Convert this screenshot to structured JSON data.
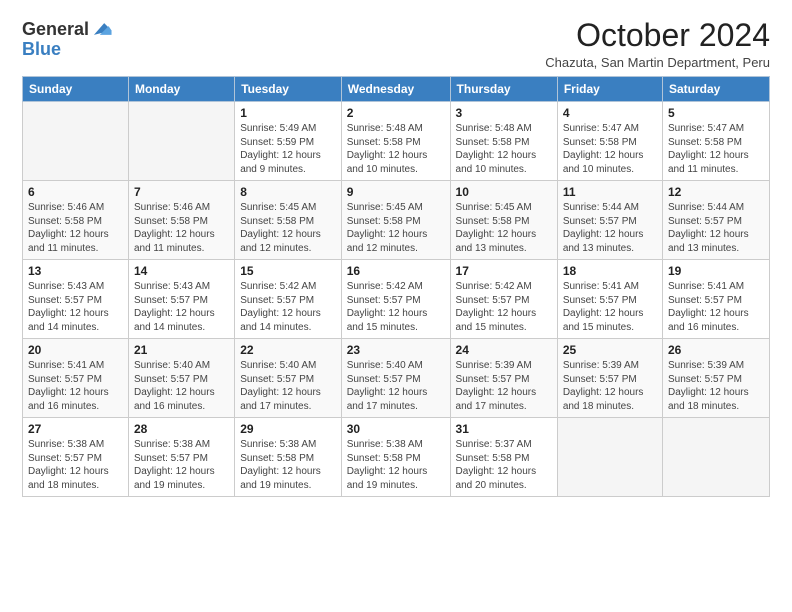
{
  "header": {
    "logo_general": "General",
    "logo_blue": "Blue",
    "month_title": "October 2024",
    "subtitle": "Chazuta, San Martin Department, Peru"
  },
  "days_of_week": [
    "Sunday",
    "Monday",
    "Tuesday",
    "Wednesday",
    "Thursday",
    "Friday",
    "Saturday"
  ],
  "weeks": [
    [
      {
        "day": "",
        "empty": true
      },
      {
        "day": "",
        "empty": true
      },
      {
        "day": "1",
        "sunrise": "Sunrise: 5:49 AM",
        "sunset": "Sunset: 5:59 PM",
        "daylight": "Daylight: 12 hours and 9 minutes."
      },
      {
        "day": "2",
        "sunrise": "Sunrise: 5:48 AM",
        "sunset": "Sunset: 5:58 PM",
        "daylight": "Daylight: 12 hours and 10 minutes."
      },
      {
        "day": "3",
        "sunrise": "Sunrise: 5:48 AM",
        "sunset": "Sunset: 5:58 PM",
        "daylight": "Daylight: 12 hours and 10 minutes."
      },
      {
        "day": "4",
        "sunrise": "Sunrise: 5:47 AM",
        "sunset": "Sunset: 5:58 PM",
        "daylight": "Daylight: 12 hours and 10 minutes."
      },
      {
        "day": "5",
        "sunrise": "Sunrise: 5:47 AM",
        "sunset": "Sunset: 5:58 PM",
        "daylight": "Daylight: 12 hours and 11 minutes."
      }
    ],
    [
      {
        "day": "6",
        "sunrise": "Sunrise: 5:46 AM",
        "sunset": "Sunset: 5:58 PM",
        "daylight": "Daylight: 12 hours and 11 minutes."
      },
      {
        "day": "7",
        "sunrise": "Sunrise: 5:46 AM",
        "sunset": "Sunset: 5:58 PM",
        "daylight": "Daylight: 12 hours and 11 minutes."
      },
      {
        "day": "8",
        "sunrise": "Sunrise: 5:45 AM",
        "sunset": "Sunset: 5:58 PM",
        "daylight": "Daylight: 12 hours and 12 minutes."
      },
      {
        "day": "9",
        "sunrise": "Sunrise: 5:45 AM",
        "sunset": "Sunset: 5:58 PM",
        "daylight": "Daylight: 12 hours and 12 minutes."
      },
      {
        "day": "10",
        "sunrise": "Sunrise: 5:45 AM",
        "sunset": "Sunset: 5:58 PM",
        "daylight": "Daylight: 12 hours and 13 minutes."
      },
      {
        "day": "11",
        "sunrise": "Sunrise: 5:44 AM",
        "sunset": "Sunset: 5:57 PM",
        "daylight": "Daylight: 12 hours and 13 minutes."
      },
      {
        "day": "12",
        "sunrise": "Sunrise: 5:44 AM",
        "sunset": "Sunset: 5:57 PM",
        "daylight": "Daylight: 12 hours and 13 minutes."
      }
    ],
    [
      {
        "day": "13",
        "sunrise": "Sunrise: 5:43 AM",
        "sunset": "Sunset: 5:57 PM",
        "daylight": "Daylight: 12 hours and 14 minutes."
      },
      {
        "day": "14",
        "sunrise": "Sunrise: 5:43 AM",
        "sunset": "Sunset: 5:57 PM",
        "daylight": "Daylight: 12 hours and 14 minutes."
      },
      {
        "day": "15",
        "sunrise": "Sunrise: 5:42 AM",
        "sunset": "Sunset: 5:57 PM",
        "daylight": "Daylight: 12 hours and 14 minutes."
      },
      {
        "day": "16",
        "sunrise": "Sunrise: 5:42 AM",
        "sunset": "Sunset: 5:57 PM",
        "daylight": "Daylight: 12 hours and 15 minutes."
      },
      {
        "day": "17",
        "sunrise": "Sunrise: 5:42 AM",
        "sunset": "Sunset: 5:57 PM",
        "daylight": "Daylight: 12 hours and 15 minutes."
      },
      {
        "day": "18",
        "sunrise": "Sunrise: 5:41 AM",
        "sunset": "Sunset: 5:57 PM",
        "daylight": "Daylight: 12 hours and 15 minutes."
      },
      {
        "day": "19",
        "sunrise": "Sunrise: 5:41 AM",
        "sunset": "Sunset: 5:57 PM",
        "daylight": "Daylight: 12 hours and 16 minutes."
      }
    ],
    [
      {
        "day": "20",
        "sunrise": "Sunrise: 5:41 AM",
        "sunset": "Sunset: 5:57 PM",
        "daylight": "Daylight: 12 hours and 16 minutes."
      },
      {
        "day": "21",
        "sunrise": "Sunrise: 5:40 AM",
        "sunset": "Sunset: 5:57 PM",
        "daylight": "Daylight: 12 hours and 16 minutes."
      },
      {
        "day": "22",
        "sunrise": "Sunrise: 5:40 AM",
        "sunset": "Sunset: 5:57 PM",
        "daylight": "Daylight: 12 hours and 17 minutes."
      },
      {
        "day": "23",
        "sunrise": "Sunrise: 5:40 AM",
        "sunset": "Sunset: 5:57 PM",
        "daylight": "Daylight: 12 hours and 17 minutes."
      },
      {
        "day": "24",
        "sunrise": "Sunrise: 5:39 AM",
        "sunset": "Sunset: 5:57 PM",
        "daylight": "Daylight: 12 hours and 17 minutes."
      },
      {
        "day": "25",
        "sunrise": "Sunrise: 5:39 AM",
        "sunset": "Sunset: 5:57 PM",
        "daylight": "Daylight: 12 hours and 18 minutes."
      },
      {
        "day": "26",
        "sunrise": "Sunrise: 5:39 AM",
        "sunset": "Sunset: 5:57 PM",
        "daylight": "Daylight: 12 hours and 18 minutes."
      }
    ],
    [
      {
        "day": "27",
        "sunrise": "Sunrise: 5:38 AM",
        "sunset": "Sunset: 5:57 PM",
        "daylight": "Daylight: 12 hours and 18 minutes."
      },
      {
        "day": "28",
        "sunrise": "Sunrise: 5:38 AM",
        "sunset": "Sunset: 5:57 PM",
        "daylight": "Daylight: 12 hours and 19 minutes."
      },
      {
        "day": "29",
        "sunrise": "Sunrise: 5:38 AM",
        "sunset": "Sunset: 5:58 PM",
        "daylight": "Daylight: 12 hours and 19 minutes."
      },
      {
        "day": "30",
        "sunrise": "Sunrise: 5:38 AM",
        "sunset": "Sunset: 5:58 PM",
        "daylight": "Daylight: 12 hours and 19 minutes."
      },
      {
        "day": "31",
        "sunrise": "Sunrise: 5:37 AM",
        "sunset": "Sunset: 5:58 PM",
        "daylight": "Daylight: 12 hours and 20 minutes."
      },
      {
        "day": "",
        "empty": true
      },
      {
        "day": "",
        "empty": true
      }
    ]
  ]
}
